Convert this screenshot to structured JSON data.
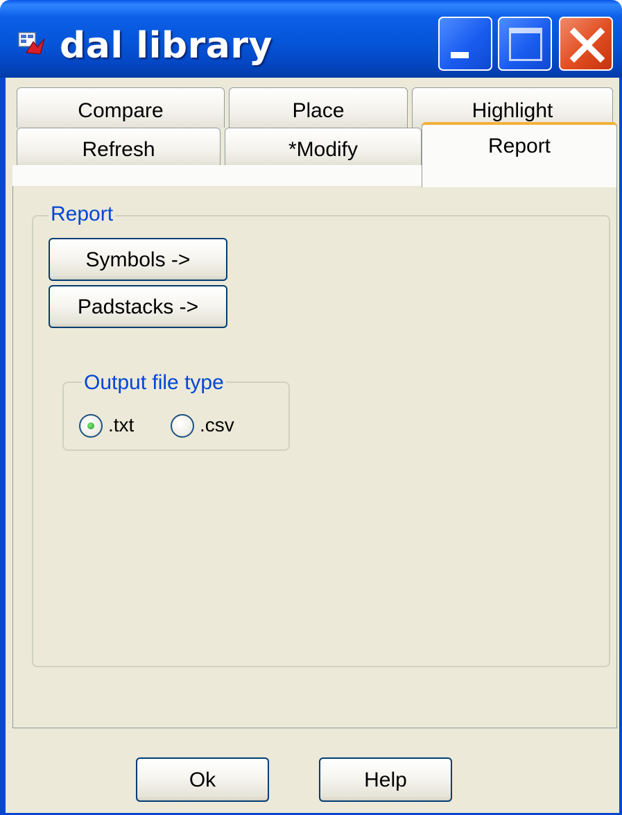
{
  "window": {
    "title": "dal library",
    "controls": {
      "minimize": "minimize-icon",
      "maximize": "maximize-icon",
      "close": "close-icon"
    }
  },
  "tabs": {
    "row1": [
      "Compare",
      "Place",
      "Highlight"
    ],
    "row2": [
      "Refresh",
      "*Modify",
      "Report"
    ],
    "active": "Report"
  },
  "report_group": {
    "legend": "Report",
    "symbols_label": "Symbols ->",
    "padstacks_label": "Padstacks ->"
  },
  "output_group": {
    "legend": "Output file type",
    "options": [
      ".txt",
      ".csv"
    ],
    "selected": ".txt"
  },
  "footer": {
    "ok_label": "Ok",
    "help_label": "Help"
  },
  "colors": {
    "titlebar": "#0555d8",
    "face": "#ece9d8",
    "group_text": "#0046d5",
    "active_tab_accent": "#f4b13a",
    "close_button": "#e24d20"
  }
}
